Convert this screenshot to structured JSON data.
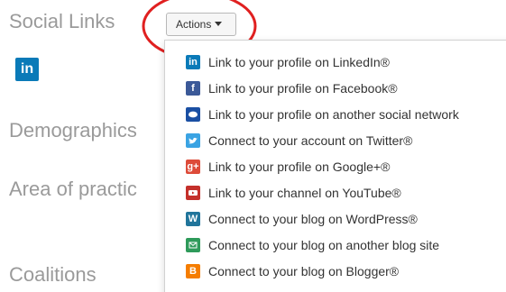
{
  "sections": {
    "social_links": "Social Links",
    "demographics": "Demographics",
    "area_of_practice": "Area of practic",
    "coalitions": "Coalitions"
  },
  "linkedin_badge": "in",
  "actions_button": {
    "label": "Actions"
  },
  "annotation_color": "#e02020",
  "menu": {
    "items": [
      {
        "label": "Link to your profile on LinkedIn®",
        "icon": "linkedin-icon",
        "glyph": "in",
        "color": "#0a7ab8"
      },
      {
        "label": "Link to your profile on Facebook®",
        "icon": "facebook-icon",
        "glyph": "f",
        "color": "#3b5998"
      },
      {
        "label": "Link to your profile on another social network",
        "icon": "social-network-icon",
        "glyph": "",
        "color": "#1a4fa3"
      },
      {
        "label": "Connect to your account on Twitter®",
        "icon": "twitter-icon",
        "glyph": "",
        "color": "#3aa3e3"
      },
      {
        "label": "Link to your profile on Google+®",
        "icon": "google-plus-icon",
        "glyph": "g+",
        "color": "#dd4b39"
      },
      {
        "label": "Link to your channel on YouTube®",
        "icon": "youtube-icon",
        "glyph": "",
        "color": "#c4302b"
      },
      {
        "label": "Connect to your blog on WordPress®",
        "icon": "wordpress-icon",
        "glyph": "W",
        "color": "#21759b"
      },
      {
        "label": "Connect to your blog on another blog site",
        "icon": "blog-site-icon",
        "glyph": "",
        "color": "#2e9a5a"
      },
      {
        "label": "Connect to your blog on Blogger®",
        "icon": "blogger-icon",
        "glyph": "B",
        "color": "#f57d00"
      }
    ]
  }
}
